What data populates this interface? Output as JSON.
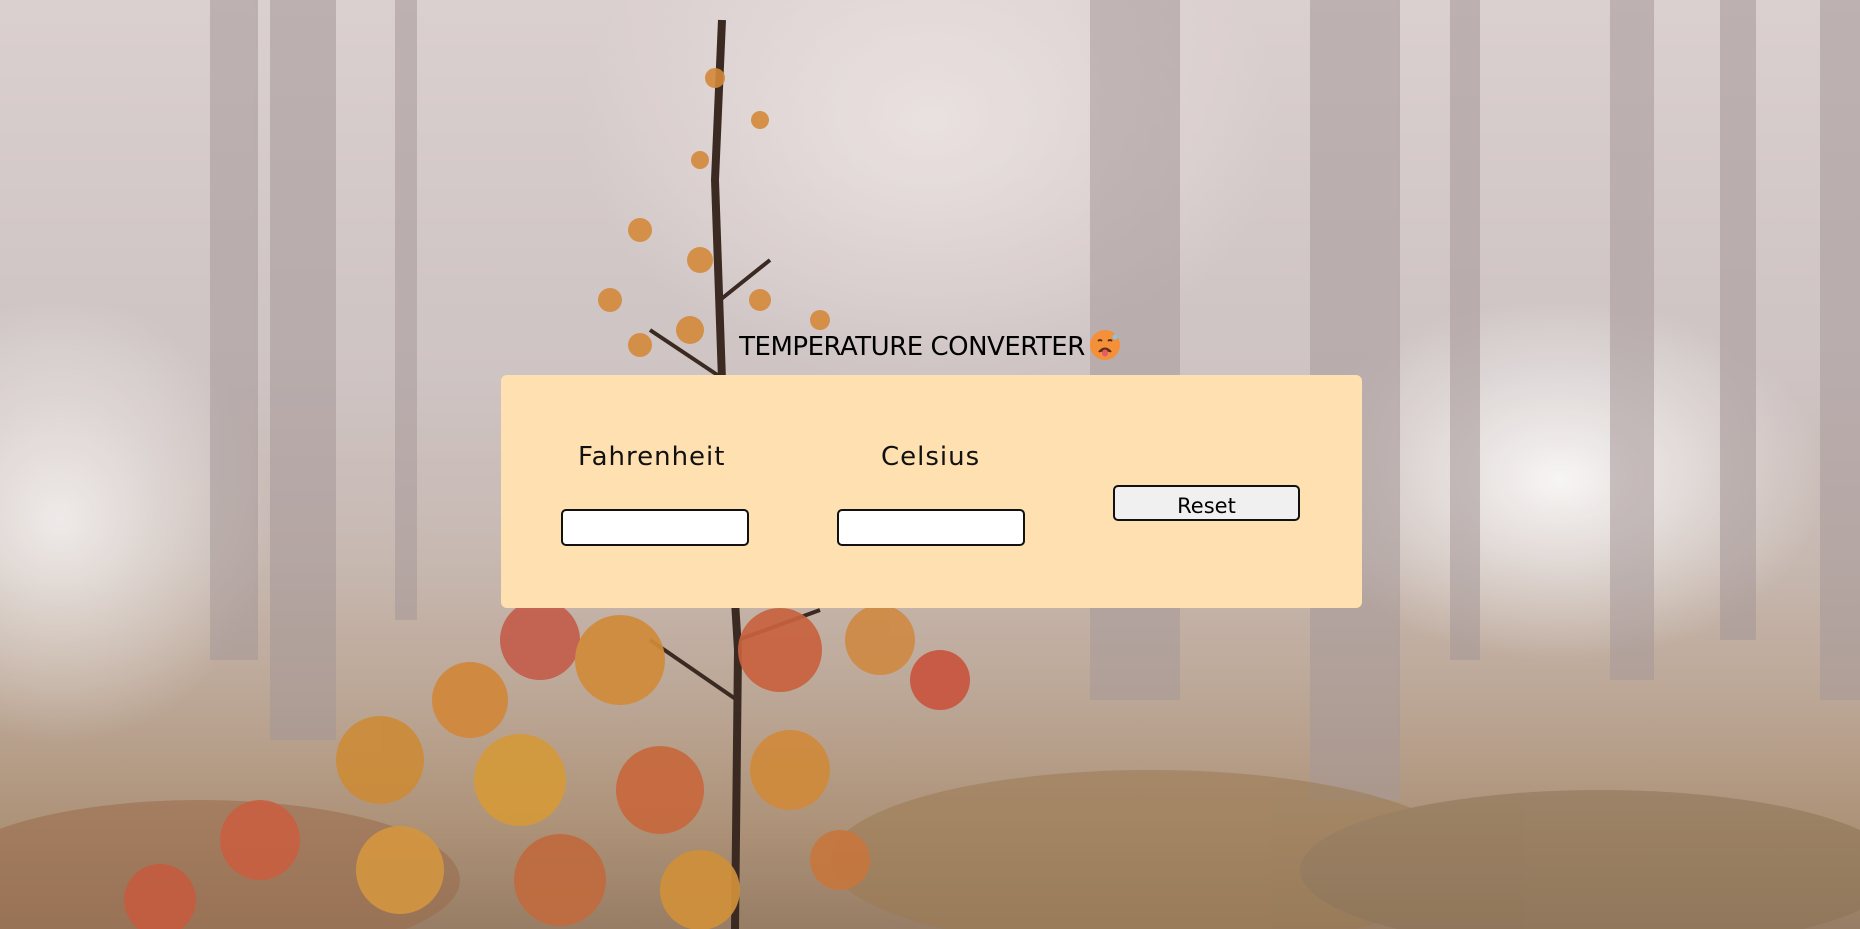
{
  "header": {
    "title": "TEMPERATURE CONVERTER",
    "emoji_icon": "hot-face-emoji"
  },
  "converter": {
    "fahrenheit_label": "Fahrenheit",
    "celsius_label": "Celsius",
    "fahrenheit_value": "",
    "celsius_value": "",
    "reset_label": "Reset"
  },
  "colors": {
    "panel_background": "#ffe0b0",
    "text": "#000000",
    "field_border": "#111111",
    "button_background": "#f0f0f0"
  }
}
